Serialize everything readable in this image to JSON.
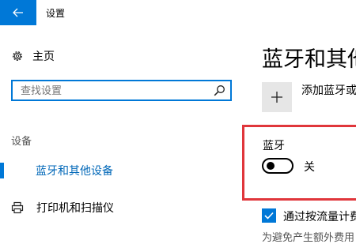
{
  "window": {
    "title": "设置"
  },
  "sidebar": {
    "home_label": "主页",
    "search": {
      "placeholder": "查找设置"
    },
    "section_label": "设备",
    "items": [
      {
        "label": "蓝牙和其他设备",
        "selected": true
      },
      {
        "label": "打印机和扫描仪",
        "selected": false
      }
    ]
  },
  "main": {
    "heading": "蓝牙和其他",
    "add_device_label": "添加蓝牙或",
    "bluetooth": {
      "label": "蓝牙",
      "toggle_state": "关",
      "on": false
    },
    "metered": {
      "label": "通过按流量计费",
      "checked": true
    },
    "hint": "为避免产生额外费用"
  },
  "colors": {
    "accent": "#0078d7",
    "highlight": "#e0363b",
    "selected_text": "#0067b8"
  },
  "icons": [
    "back-arrow-icon",
    "gear-icon",
    "search-icon",
    "printer-icon",
    "plus-icon",
    "checkmark-icon"
  ]
}
